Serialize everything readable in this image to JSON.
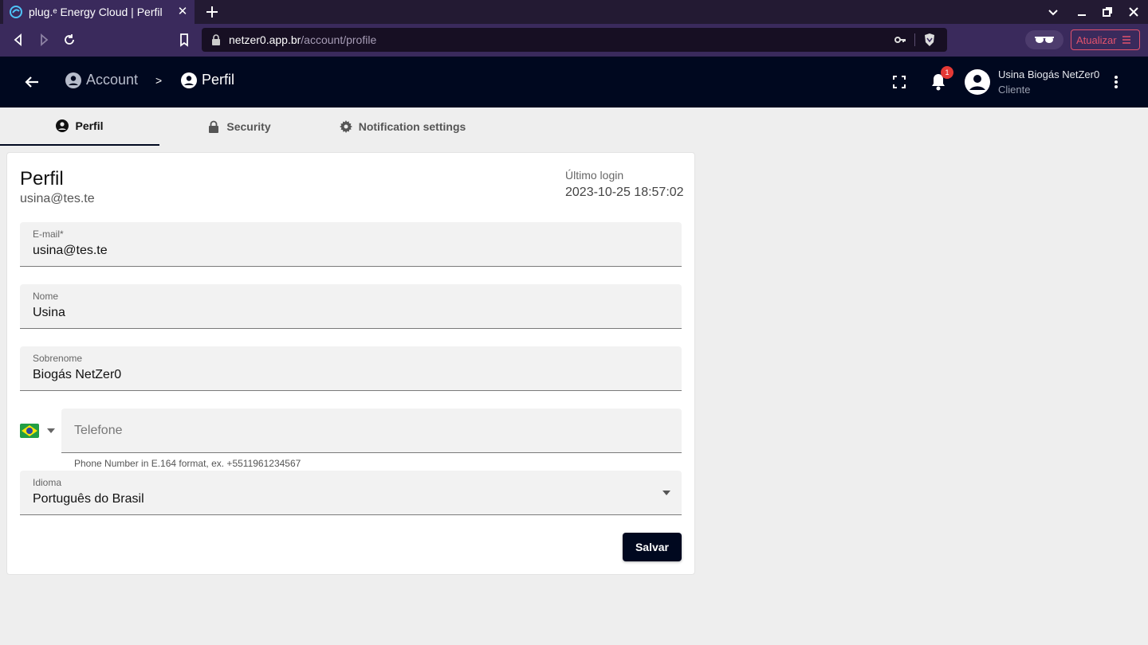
{
  "browser": {
    "tab_title": "plug.ᵉ Energy Cloud | Perfil",
    "url_host": "netzer0.app.br",
    "url_path": "/account/profile",
    "update_button": "Atualizar"
  },
  "header": {
    "crumb_account": "Account",
    "crumb_separator": ">",
    "crumb_profile": "Perfil",
    "notification_count": "1",
    "user_name": "Usina Biogás NetZer0",
    "user_role": "Cliente"
  },
  "tabs": [
    {
      "label": "Perfil",
      "icon": "account-circle-icon",
      "active": true
    },
    {
      "label": "Security",
      "icon": "lock-icon",
      "active": false
    },
    {
      "label": "Notification settings",
      "icon": "gear-icon",
      "active": false
    }
  ],
  "profile": {
    "title": "Perfil",
    "email_display": "usina@tes.te",
    "last_login_label": "Último login",
    "last_login_value": "2023-10-25 18:57:02",
    "email": {
      "label": "E-mail*",
      "value": "usina@tes.te"
    },
    "first_name": {
      "label": "Nome",
      "value": "Usina"
    },
    "last_name": {
      "label": "Sobrenome",
      "value": "Biogás NetZer0"
    },
    "phone": {
      "placeholder": "Telefone",
      "hint": "Phone Number in E.164 format, ex. +5511961234567",
      "country_flag": "brazil-flag-icon"
    },
    "language": {
      "label": "Idioma",
      "value": "Português do Brasil"
    },
    "save_label": "Salvar"
  },
  "colors": {
    "browser_bg": "#3a2a5c",
    "appbar_bg": "#00081f",
    "badge": "#e53935",
    "update_accent": "#e2536d"
  }
}
